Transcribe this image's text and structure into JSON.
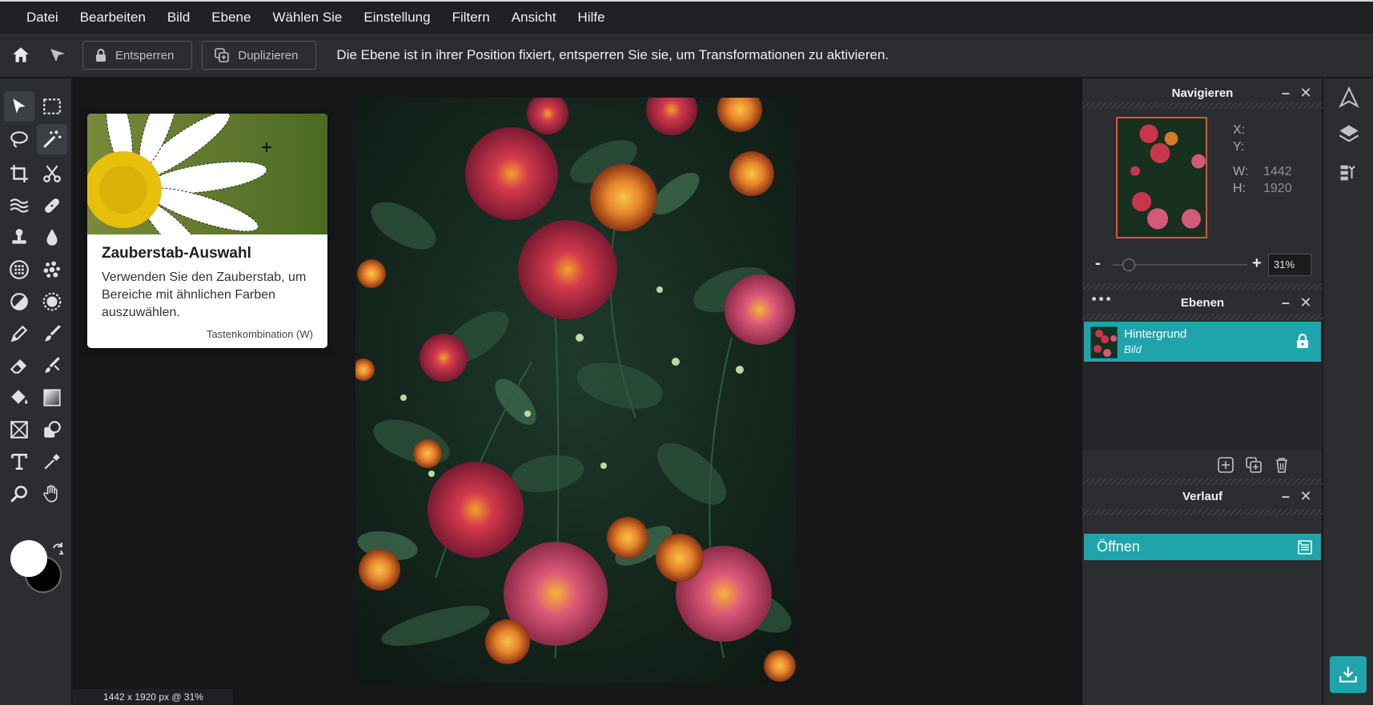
{
  "menu": [
    "Datei",
    "Bearbeiten",
    "Bild",
    "Ebene",
    "Wählen Sie",
    "Einstellung",
    "Filtern",
    "Ansicht",
    "Hilfe"
  ],
  "optionbar": {
    "unlock_label": "Entsperren",
    "duplicate_label": "Duplizieren",
    "message": "Die Ebene ist in ihrer Position fixiert, entsperren Sie sie, um Transformationen zu aktivieren."
  },
  "tooltip": {
    "title": "Zauberstab-Auswahl",
    "body": "Verwenden Sie den Zauberstab, um Bereiche mit ähnlichen Farben auszuwählen.",
    "shortcut": "Tastenkombination (W)"
  },
  "statusbar": "1442 x 1920 px @ 31%",
  "navigator": {
    "title": "Navigieren",
    "x_label": "X:",
    "y_label": "Y:",
    "w_label": "W:",
    "w_value": "1442",
    "h_label": "H:",
    "h_value": "1920",
    "zoom_minus": "-",
    "zoom_plus": "+",
    "zoom_value": "31%",
    "zoom_slider_fraction": 0.12
  },
  "layers": {
    "title": "Ebenen",
    "items": [
      {
        "name": "Hintergrund",
        "type": "Bild",
        "locked": true
      }
    ]
  },
  "history": {
    "title": "Verlauf",
    "items": [
      "Öffnen"
    ]
  },
  "colors": {
    "accent": "#1fa4ab",
    "foreground": "#ffffff",
    "background": "#000000"
  }
}
